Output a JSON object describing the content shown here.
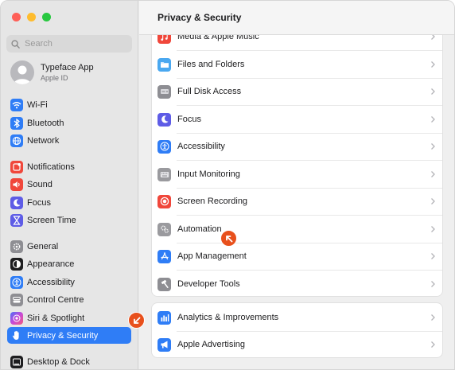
{
  "window": {
    "title": "Privacy & Security"
  },
  "search": {
    "placeholder": "Search"
  },
  "profile": {
    "name": "Typeface App",
    "subtitle": "Apple ID"
  },
  "sidebar": {
    "items": [
      {
        "label": "Wi-Fi",
        "icon": "wifi-icon",
        "color": "#2f7df6"
      },
      {
        "label": "Bluetooth",
        "icon": "bluetooth-icon",
        "color": "#2f7df6"
      },
      {
        "label": "Network",
        "icon": "globe-icon",
        "color": "#2f7df6"
      },
      {
        "label": "Notifications",
        "icon": "bell-icon",
        "color": "#f0473b"
      },
      {
        "label": "Sound",
        "icon": "speaker-icon",
        "color": "#f0473b"
      },
      {
        "label": "Focus",
        "icon": "moon-icon",
        "color": "#5e5ce6"
      },
      {
        "label": "Screen Time",
        "icon": "hourglass-icon",
        "color": "#5e5ce6"
      },
      {
        "label": "General",
        "icon": "gear-icon",
        "color": "#8e8e93"
      },
      {
        "label": "Appearance",
        "icon": "appearance-icon",
        "color": "#1d1d1f"
      },
      {
        "label": "Accessibility",
        "icon": "accessibility-icon",
        "color": "#2f7df6"
      },
      {
        "label": "Control Centre",
        "icon": "control-centre-icon",
        "color": "#8e8e93"
      },
      {
        "label": "Siri & Spotlight",
        "icon": "siri-icon",
        "color": "#8a4fd8"
      },
      {
        "label": "Privacy & Security",
        "icon": "hand-icon",
        "color": "#2f7df6",
        "selected": true
      },
      {
        "label": "Desktop & Dock",
        "icon": "dock-icon",
        "color": "#1d1d1f"
      }
    ]
  },
  "main": {
    "group1": [
      {
        "label": "Media & Apple Music",
        "icon": "music-icon",
        "color": "#f0473b"
      },
      {
        "label": "Files and Folders",
        "icon": "folder-icon",
        "color": "#4aa8f0"
      },
      {
        "label": "Full Disk Access",
        "icon": "disk-icon",
        "color": "#8e8e93"
      },
      {
        "label": "Focus",
        "icon": "moon-icon",
        "color": "#5e5ce6"
      },
      {
        "label": "Accessibility",
        "icon": "accessibility-icon",
        "color": "#2f7df6"
      },
      {
        "label": "Input Monitoring",
        "icon": "keyboard-icon",
        "color": "#9a9a9e"
      },
      {
        "label": "Screen Recording",
        "icon": "record-icon",
        "color": "#f0473b"
      },
      {
        "label": "Automation",
        "icon": "gears-icon",
        "color": "#9a9a9e"
      },
      {
        "label": "App Management",
        "icon": "app-store-icon",
        "color": "#2f7df6"
      },
      {
        "label": "Developer Tools",
        "icon": "hammer-icon",
        "color": "#8e8e93"
      }
    ],
    "group2": [
      {
        "label": "Analytics & Improvements",
        "icon": "analytics-icon",
        "color": "#2f7df6"
      },
      {
        "label": "Apple Advertising",
        "icon": "megaphone-icon",
        "color": "#2f7df6"
      }
    ]
  },
  "accent": {
    "selection": "#2f7df6",
    "cursor": "#e8501c"
  }
}
